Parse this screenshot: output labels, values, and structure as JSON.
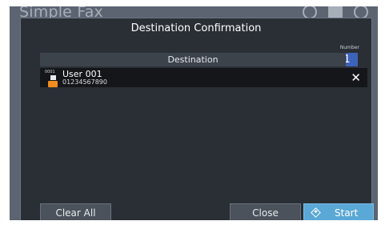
{
  "app": {
    "title": "Simple Fax"
  },
  "dialog": {
    "title": "Destination Confirmation",
    "count_label": "Number",
    "count_value": "1",
    "list_header": "Destination"
  },
  "destinations": [
    {
      "id": "0001",
      "name": "User 001",
      "number": "01234567890",
      "remove_icon": "✕"
    }
  ],
  "buttons": {
    "clear_all": "Clear All",
    "close": "Close",
    "start": "Start"
  },
  "colors": {
    "accent": "#5aa8d6",
    "count_badge": "#3d63b8"
  }
}
